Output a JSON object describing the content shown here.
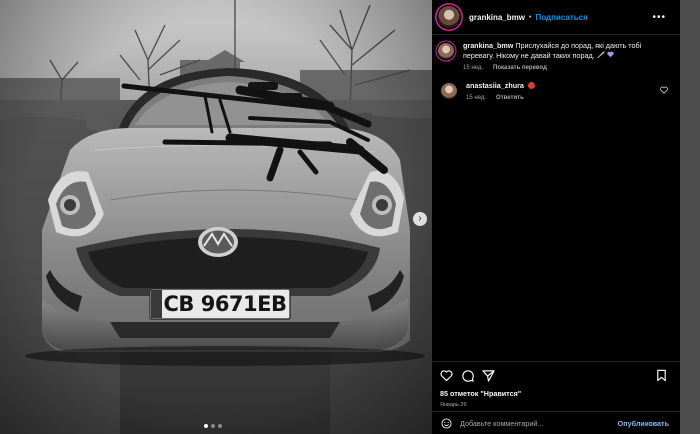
{
  "post": {
    "author": "grankina_bmw",
    "follow_label": "Подписаться",
    "separator": "•",
    "more_label": "•••",
    "caption_text": "Прислухайся до порад, які дають тобі перевагу. Нікому не давай таких порад.",
    "caption_time": "15 нед.",
    "translate_label": "Показать перевод",
    "plate": "CB 9671EB",
    "plate_country": "UA",
    "carousel_dots": 3,
    "carousel_active": 1
  },
  "comments": [
    {
      "author": "anastasiia_zhura",
      "time": "15 нед.",
      "reply_label": "Ответить"
    }
  ],
  "footer": {
    "likes": "85 отметок \"Нравится\"",
    "date": "Январь 29",
    "comment_placeholder": "Добавьте комментарий...",
    "publish_label": "Опубликовать"
  },
  "icons": {
    "next": "chevron-right-icon",
    "like": "heart-icon",
    "comment": "speech-bubble-icon",
    "share": "paper-plane-icon",
    "save": "bookmark-icon",
    "emoji": "smiley-icon"
  },
  "colors": {
    "link_blue": "#0095f6",
    "publish_blue": "#7dbbf0",
    "story_ring": "#d6249f"
  }
}
